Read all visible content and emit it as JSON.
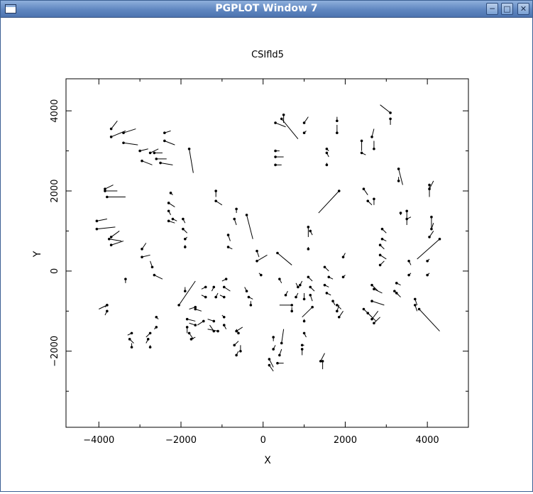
{
  "window": {
    "title": "PGPLOT Window 7",
    "buttons": [
      "minimize-icon",
      "maximize-icon",
      "close-icon"
    ]
  },
  "chart_data": {
    "type": "scatter",
    "title": "CSIfld5",
    "xlabel": "X",
    "ylabel": "Y",
    "xlim": [
      -4800,
      5000
    ],
    "ylim": [
      -3900,
      4800
    ],
    "x_ticks": [
      -4000,
      -2000,
      0,
      2000,
      4000
    ],
    "x_tick_labels": [
      "−4000",
      "−2000",
      "0",
      "2000",
      "4000"
    ],
    "y_ticks": [
      -2000,
      0,
      2000,
      4000
    ],
    "y_tick_labels": [
      "−2000",
      "0",
      "2000",
      "4000"
    ],
    "marker": "dot",
    "vector_color": "#000000",
    "vectors": [
      [
        -3700,
        3550,
        -3550,
        3750
      ],
      [
        -3700,
        3350,
        -3350,
        3500
      ],
      [
        -3400,
        3450,
        -3100,
        3550
      ],
      [
        -3400,
        3200,
        -3050,
        3150
      ],
      [
        -3000,
        3000,
        -2800,
        3050
      ],
      [
        -2950,
        2750,
        -2700,
        2650
      ],
      [
        -2750,
        2950,
        -2550,
        3050
      ],
      [
        -2650,
        2950,
        -2450,
        2950
      ],
      [
        -2600,
        2800,
        -2350,
        2800
      ],
      [
        -2500,
        2700,
        -2200,
        2650
      ],
      [
        -2400,
        3450,
        -2250,
        3500
      ],
      [
        -2400,
        3250,
        -2150,
        3150
      ],
      [
        -1800,
        3050,
        -1700,
        2450
      ],
      [
        -3850,
        2050,
        -3650,
        2150
      ],
      [
        -3800,
        1850,
        -3350,
        1850
      ],
      [
        -3850,
        2000,
        -3550,
        2000
      ],
      [
        -4050,
        1250,
        -3800,
        1300
      ],
      [
        -4050,
        1050,
        -3600,
        1100
      ],
      [
        -3700,
        850,
        -3500,
        1000
      ],
      [
        -3700,
        650,
        -3400,
        750
      ],
      [
        -3750,
        800,
        -3450,
        750
      ],
      [
        -2950,
        550,
        -2850,
        700
      ],
      [
        -2950,
        350,
        -2750,
        400
      ],
      [
        -2700,
        100,
        -2750,
        250
      ],
      [
        -2650,
        -100,
        -2450,
        -200
      ],
      [
        -3350,
        -200,
        -3350,
        -300
      ],
      [
        -2250,
        1950,
        -2200,
        1900
      ],
      [
        -2300,
        1700,
        -2150,
        1600
      ],
      [
        -2300,
        1500,
        -2250,
        1400
      ],
      [
        -2200,
        1300,
        -2100,
        1250
      ],
      [
        -2300,
        1250,
        -2150,
        1200
      ],
      [
        -1950,
        1300,
        -1900,
        1200
      ],
      [
        -1950,
        1050,
        -1850,
        950
      ],
      [
        -1900,
        800,
        -1850,
        850
      ],
      [
        -1900,
        600,
        -1900,
        650
      ],
      [
        -1150,
        2000,
        -1150,
        1850
      ],
      [
        -1150,
        1750,
        -1000,
        1650
      ],
      [
        -650,
        1550,
        -650,
        1450
      ],
      [
        -700,
        1300,
        -650,
        1150
      ],
      [
        -850,
        900,
        -800,
        750
      ],
      [
        -850,
        600,
        -750,
        550
      ],
      [
        -400,
        1400,
        -250,
        800
      ],
      [
        -150,
        500,
        -100,
        350
      ],
      [
        -150,
        250,
        100,
        400
      ],
      [
        -400,
        -500,
        -450,
        -400
      ],
      [
        -350,
        -650,
        -250,
        -700
      ],
      [
        -300,
        -850,
        -300,
        -750
      ],
      [
        -50,
        -100,
        -100,
        -50
      ],
      [
        350,
        450,
        700,
        150
      ],
      [
        1850,
        2000,
        1350,
        1450
      ],
      [
        450,
        3800,
        850,
        3300
      ],
      [
        500,
        3900,
        500,
        3700
      ],
      [
        300,
        3700,
        550,
        3600
      ],
      [
        300,
        3000,
        400,
        3000
      ],
      [
        300,
        2850,
        500,
        2850
      ],
      [
        300,
        2650,
        450,
        2650
      ],
      [
        1000,
        3700,
        1100,
        3850
      ],
      [
        1000,
        3450,
        1050,
        3500
      ],
      [
        1800,
        3750,
        1800,
        3850
      ],
      [
        1800,
        3450,
        1800,
        3650
      ],
      [
        1550,
        3050,
        1600,
        3000
      ],
      [
        1550,
        2950,
        1600,
        2850
      ],
      [
        1550,
        2650,
        1550,
        2700
      ],
      [
        2400,
        3250,
        2400,
        3000
      ],
      [
        2400,
        2950,
        2500,
        2900
      ],
      [
        2650,
        3350,
        2700,
        3550
      ],
      [
        2700,
        3050,
        2700,
        3250
      ],
      [
        3100,
        3950,
        2850,
        4150
      ],
      [
        3100,
        3800,
        3100,
        3650
      ],
      [
        2450,
        2050,
        2550,
        1900
      ],
      [
        2550,
        1750,
        2650,
        1650
      ],
      [
        2700,
        1800,
        2700,
        1650
      ],
      [
        3300,
        2550,
        3400,
        2150
      ],
      [
        3300,
        2250,
        3300,
        2350
      ],
      [
        4050,
        2150,
        4050,
        1850
      ],
      [
        4050,
        2050,
        4150,
        2250
      ],
      [
        3350,
        1450,
        3350,
        1400
      ],
      [
        3500,
        1500,
        3500,
        1150
      ],
      [
        3500,
        1300,
        3600,
        1350
      ],
      [
        4100,
        1350,
        4100,
        1050
      ],
      [
        4100,
        1050,
        4150,
        1200
      ],
      [
        4050,
        850,
        4150,
        1000
      ],
      [
        2900,
        1050,
        3000,
        950
      ],
      [
        2900,
        800,
        3000,
        750
      ],
      [
        2850,
        650,
        2950,
        550
      ],
      [
        2850,
        400,
        3000,
        300
      ],
      [
        2850,
        150,
        2950,
        250
      ],
      [
        4300,
        800,
        3750,
        300
      ],
      [
        4000,
        250,
        4050,
        300
      ],
      [
        4000,
        -100,
        4050,
        -50
      ],
      [
        3550,
        250,
        3600,
        150
      ],
      [
        3550,
        -100,
        3600,
        -50
      ],
      [
        3800,
        -950,
        4300,
        -1500
      ],
      [
        3700,
        -700,
        3750,
        -850
      ],
      [
        3700,
        -850,
        3750,
        -1000
      ],
      [
        3250,
        -300,
        3350,
        -350
      ],
      [
        3200,
        -500,
        3300,
        -600
      ],
      [
        3250,
        -550,
        3350,
        -650
      ],
      [
        2650,
        -350,
        2800,
        -500
      ],
      [
        2700,
        -450,
        2900,
        -550
      ],
      [
        2650,
        -750,
        2950,
        -850
      ],
      [
        2450,
        -950,
        2650,
        -1150
      ],
      [
        2550,
        -1050,
        2750,
        -1250
      ],
      [
        2650,
        -1200,
        2800,
        -1000
      ],
      [
        2700,
        -1300,
        2850,
        -1150
      ],
      [
        1200,
        -900,
        950,
        -1150
      ],
      [
        1150,
        -600,
        1200,
        -750
      ],
      [
        1150,
        -400,
        1250,
        -500
      ],
      [
        1100,
        -150,
        1200,
        -250
      ],
      [
        900,
        -350,
        950,
        -250
      ],
      [
        1000,
        -700,
        1000,
        -550
      ],
      [
        1600,
        -150,
        1700,
        -200
      ],
      [
        1500,
        -350,
        1600,
        -400
      ],
      [
        1550,
        -550,
        1650,
        -600
      ],
      [
        1700,
        -750,
        1750,
        -850
      ],
      [
        1800,
        -1000,
        1850,
        -850
      ],
      [
        1800,
        -850,
        1900,
        -950
      ],
      [
        1850,
        -1150,
        1950,
        -1000
      ],
      [
        1950,
        -150,
        2000,
        -100
      ],
      [
        1950,
        350,
        2000,
        450
      ],
      [
        1500,
        100,
        1600,
        0
      ],
      [
        1100,
        1100,
        1100,
        850
      ],
      [
        1150,
        1000,
        1200,
        900
      ],
      [
        1100,
        550,
        1100,
        600
      ],
      [
        1000,
        -1250,
        1000,
        -1200
      ],
      [
        1000,
        -1550,
        1050,
        -1650
      ],
      [
        950,
        -1850,
        1000,
        -1850
      ],
      [
        950,
        -1950,
        950,
        -2100
      ],
      [
        450,
        -1800,
        500,
        -1450
      ],
      [
        400,
        -2100,
        450,
        -1950
      ],
      [
        350,
        -2300,
        500,
        -2300
      ],
      [
        250,
        -1950,
        300,
        -1850
      ],
      [
        150,
        -2200,
        250,
        -2400
      ],
      [
        150,
        -2350,
        250,
        -2500
      ],
      [
        250,
        -1650,
        250,
        -1750
      ],
      [
        1400,
        -2250,
        1500,
        -2050
      ],
      [
        1450,
        -2250,
        1450,
        -2450
      ],
      [
        700,
        -850,
        400,
        -850
      ],
      [
        700,
        -1000,
        700,
        -900
      ],
      [
        850,
        -400,
        800,
        -300
      ],
      [
        800,
        -650,
        850,
        -550
      ],
      [
        400,
        -200,
        450,
        -300
      ],
      [
        550,
        -600,
        600,
        -500
      ],
      [
        -700,
        -1850,
        -600,
        -1750
      ],
      [
        -550,
        -2000,
        -550,
        -1850
      ],
      [
        -650,
        -2100,
        -600,
        -2000
      ],
      [
        -600,
        -1550,
        -650,
        -1450
      ],
      [
        -650,
        -1500,
        -500,
        -1400
      ],
      [
        -950,
        -1150,
        -1000,
        -1100
      ],
      [
        -950,
        -1350,
        -900,
        -1450
      ],
      [
        -1100,
        -1500,
        -1350,
        -1450
      ],
      [
        -1200,
        -1500,
        -1300,
        -1350
      ],
      [
        -1200,
        -1250,
        -1350,
        -1200
      ],
      [
        -1450,
        -1250,
        -1600,
        -1350
      ],
      [
        -1650,
        -1350,
        -1800,
        -1300
      ],
      [
        -1850,
        -1200,
        -1650,
        -1250
      ],
      [
        -1850,
        -1400,
        -1850,
        -1550
      ],
      [
        -1800,
        -1550,
        -1700,
        -1700
      ],
      [
        -1750,
        -1700,
        -1650,
        -1650
      ],
      [
        -1900,
        -500,
        -1900,
        -400
      ],
      [
        -2050,
        -850,
        -1650,
        -250
      ],
      [
        -1650,
        -900,
        -1800,
        -950
      ],
      [
        -1650,
        -950,
        -1500,
        -1000
      ],
      [
        -1400,
        -400,
        -1500,
        -450
      ],
      [
        -1400,
        -650,
        -1500,
        -600
      ],
      [
        -1200,
        -400,
        -1250,
        -500
      ],
      [
        -1150,
        -650,
        -1100,
        -550
      ],
      [
        -900,
        -200,
        -1000,
        -250
      ],
      [
        -950,
        -400,
        -800,
        -500
      ],
      [
        -950,
        -650,
        -1050,
        -600
      ],
      [
        -2600,
        -1150,
        -2550,
        -1200
      ],
      [
        -2600,
        -1400,
        -2650,
        -1450
      ],
      [
        -2750,
        -1550,
        -2850,
        -1650
      ],
      [
        -2800,
        -1700,
        -2850,
        -1800
      ],
      [
        -2750,
        -1900,
        -2750,
        -1850
      ],
      [
        -3200,
        -1550,
        -3300,
        -1600
      ],
      [
        -3250,
        -1700,
        -3150,
        -1800
      ],
      [
        -3200,
        -1900,
        -3200,
        -1800
      ],
      [
        -3800,
        -850,
        -4000,
        -950
      ],
      [
        -3800,
        -1000,
        -3850,
        -1100
      ],
      [
        -3800,
        -850,
        -3850,
        -900
      ]
    ]
  }
}
